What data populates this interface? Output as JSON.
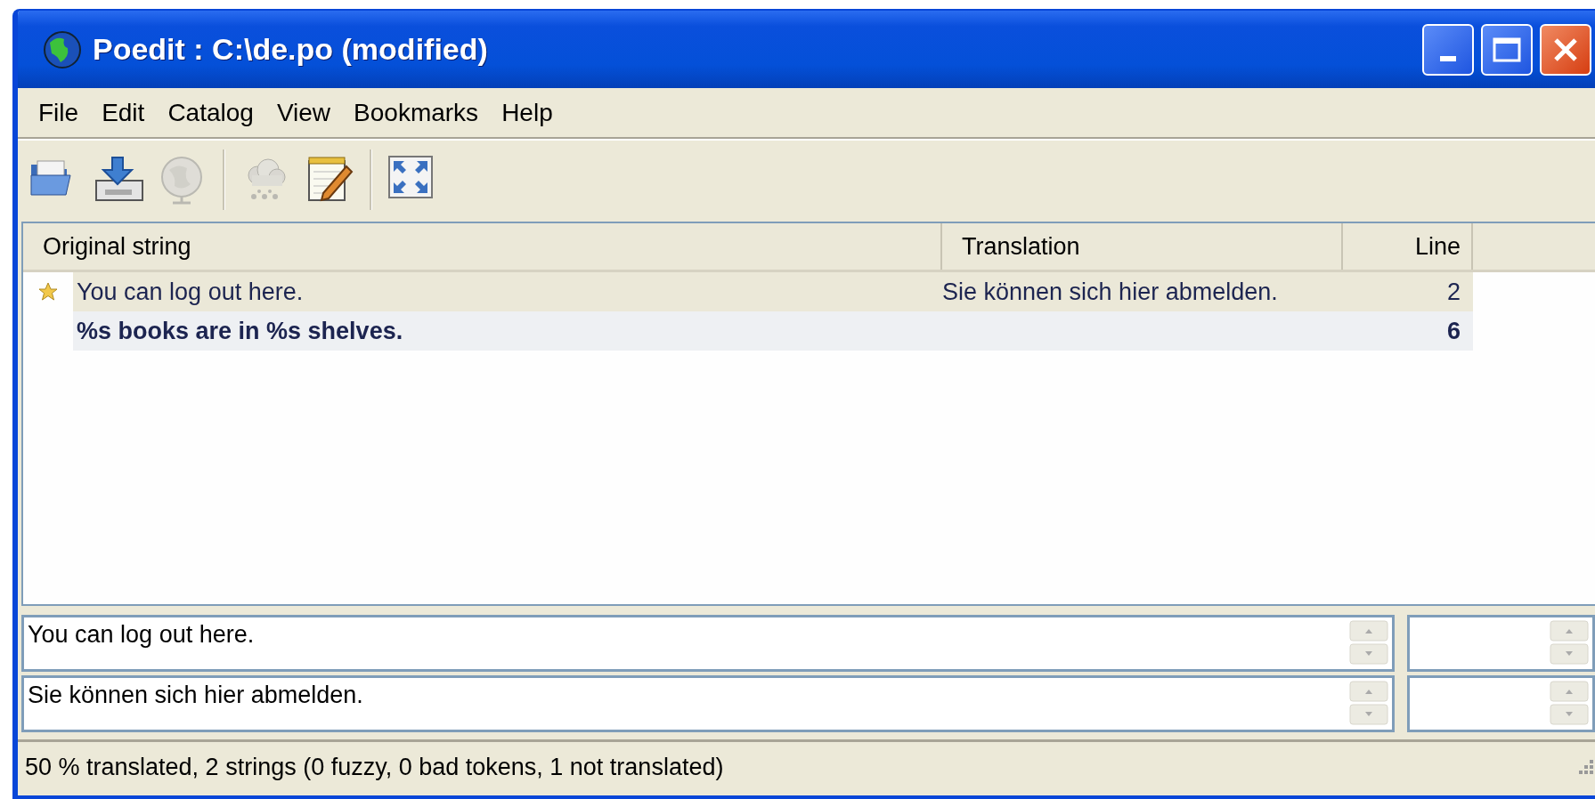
{
  "window": {
    "title": "Poedit : C:\\de.po (modified)"
  },
  "menu": [
    "File",
    "Edit",
    "Catalog",
    "View",
    "Bookmarks",
    "Help"
  ],
  "toolbar": [
    {
      "kind": "open",
      "disabled": false
    },
    {
      "kind": "save",
      "disabled": false
    },
    {
      "kind": "update",
      "disabled": true
    },
    {
      "kind": "validate",
      "disabled": true
    },
    {
      "kind": "comment",
      "disabled": false
    },
    {
      "kind": "fullscreen",
      "disabled": false
    }
  ],
  "table": {
    "columns": [
      "Original string",
      "Translation",
      "Line"
    ],
    "rows": [
      {
        "original": "You can log out here.",
        "translation": "Sie können sich hier abmelden.",
        "line": "2",
        "bookmarked": true,
        "translated": true,
        "selected": true
      },
      {
        "original": "%s books are in %s shelves.",
        "line": "6",
        "bookmarked": false,
        "translated": false,
        "selected": false
      }
    ]
  },
  "editor": {
    "original": "You can log out here.",
    "translation": "Sie können sich hier abmelden."
  },
  "status_bar": "50 % translated, 2 strings (0 fuzzy, 0 bad tokens, 1 not translated)"
}
